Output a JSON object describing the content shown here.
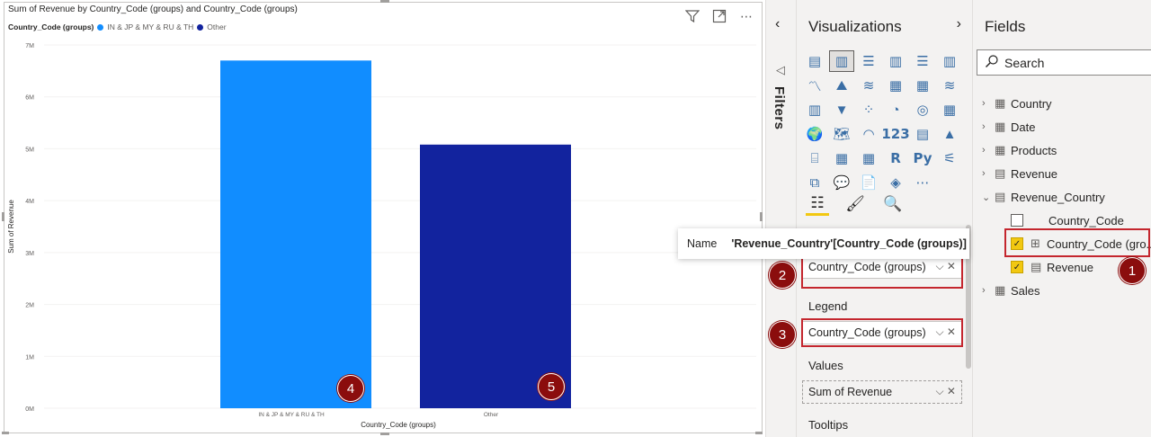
{
  "chart_title": "Sum of Revenue by Country_Code (groups) and Country_Code (groups)",
  "legend": {
    "title": "Country_Code (groups)",
    "items": [
      {
        "label": "IN & JP & MY & RU & TH",
        "color": "#118dff"
      },
      {
        "label": "Other",
        "color": "#12239e"
      }
    ]
  },
  "chart_data": {
    "type": "bar",
    "categories": [
      "IN & JP & MY & RU & TH",
      "Other"
    ],
    "values": [
      6700000,
      5080000
    ],
    "colors": [
      "#118dff",
      "#12239e"
    ],
    "xlabel": "Country_Code (groups)",
    "ylabel": "Sum of Revenue",
    "ylim": [
      0,
      7000000
    ],
    "yticks": [
      "0M",
      "1M",
      "2M",
      "3M",
      "4M",
      "5M",
      "6M",
      "7M"
    ],
    "grid": true
  },
  "filters": {
    "label": "Filters"
  },
  "visualizations": {
    "title": "Visualizations",
    "icons": [
      "stacked-bar-icon",
      "stacked-column-icon",
      "clustered-bar-icon",
      "clustered-column-icon",
      "100-bar-icon",
      "100-column-icon",
      "line-chart-icon",
      "area-chart-icon",
      "stacked-area-icon",
      "line-column-icon",
      "line-clustered-icon",
      "ribbon-chart-icon",
      "waterfall-icon",
      "funnel-icon",
      "scatter-icon",
      "pie-icon",
      "donut-icon",
      "treemap-icon",
      "map-icon",
      "filled-map-icon",
      "gauge-icon",
      "card-icon",
      "multi-row-card-icon",
      "kpi-icon",
      "slicer-icon",
      "table-icon",
      "matrix-icon",
      "r-visual-icon",
      "python-visual-icon",
      "key-influencers-icon",
      "decomposition-tree-icon",
      "qa-icon",
      "smart-narrative-icon",
      "power-apps-icon",
      "more-icon"
    ],
    "icon_glyphs": [
      "▤",
      "▥",
      "☰",
      "▥",
      "☰",
      "▥",
      "〽",
      "⛰",
      "≋",
      "▦",
      "▦",
      "≋",
      "▥",
      "▼",
      "⁘",
      "◔",
      "◎",
      "▦",
      "🌍",
      "🗺",
      "◠",
      "123",
      "▤",
      "▲",
      "⌸",
      "▦",
      "▦",
      "R",
      "Py",
      "⚟",
      "⧉",
      "💬",
      "📄",
      "◈",
      "⋯"
    ],
    "x_axis_label": "",
    "x_axis_field": "Country_Code (groups)",
    "legend_label": "Legend",
    "legend_field": "Country_Code (groups)",
    "values_label": "Values",
    "values_field": "Sum of Revenue",
    "tooltips_label": "Tooltips"
  },
  "tooltip": {
    "key": "Name",
    "value": "'Revenue_Country'[Country_Code (groups)]"
  },
  "fields": {
    "title": "Fields",
    "search_placeholder": "Search",
    "tables": [
      "Country",
      "Date",
      "Products",
      "Revenue",
      "Revenue_Country"
    ],
    "revenue_country_fields": [
      "Country_Code",
      "Country_Code (gro...",
      "Revenue"
    ],
    "sales_table": "Sales"
  },
  "badges": [
    "1",
    "2",
    "3",
    "4",
    "5"
  ]
}
